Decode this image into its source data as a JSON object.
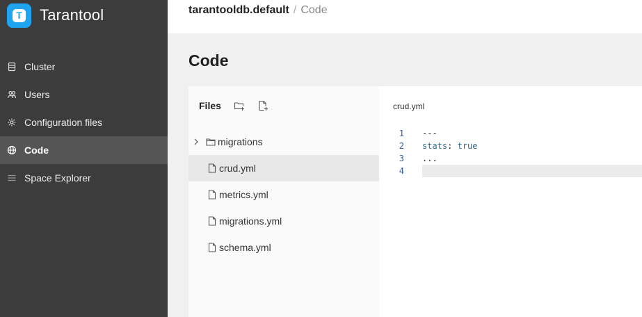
{
  "app": {
    "brand_name": "Tarantool",
    "logo_letter": "T",
    "accent_color": "#1ea4f0"
  },
  "sidebar": {
    "items": [
      {
        "label": "Cluster",
        "icon": "server-icon",
        "active": false
      },
      {
        "label": "Users",
        "icon": "users-icon",
        "active": false
      },
      {
        "label": "Configuration files",
        "icon": "gear-icon",
        "active": false
      },
      {
        "label": "Code",
        "icon": "globe-icon",
        "active": true
      },
      {
        "label": "Space Explorer",
        "icon": "list-icon",
        "active": false
      }
    ]
  },
  "breadcrumb": {
    "root": "tarantooldb.default",
    "separator": "/",
    "current": "Code"
  },
  "page": {
    "title": "Code"
  },
  "files_panel": {
    "title": "Files",
    "new_folder_icon": "new-folder-icon",
    "new_file_icon": "new-file-icon",
    "tree": [
      {
        "type": "folder",
        "name": "migrations",
        "expanded": false
      },
      {
        "type": "file",
        "name": "crud.yml",
        "selected": true
      },
      {
        "type": "file",
        "name": "metrics.yml",
        "selected": false
      },
      {
        "type": "file",
        "name": "migrations.yml",
        "selected": false
      },
      {
        "type": "file",
        "name": "schema.yml",
        "selected": false
      }
    ]
  },
  "editor": {
    "open_file": "crud.yml",
    "lines": [
      {
        "number": "1",
        "text": "---"
      },
      {
        "number": "2",
        "key": "stats",
        "colon": ":",
        "value": "true"
      },
      {
        "number": "3",
        "text": "..."
      },
      {
        "number": "4",
        "text": ""
      }
    ],
    "current_line": 4
  }
}
